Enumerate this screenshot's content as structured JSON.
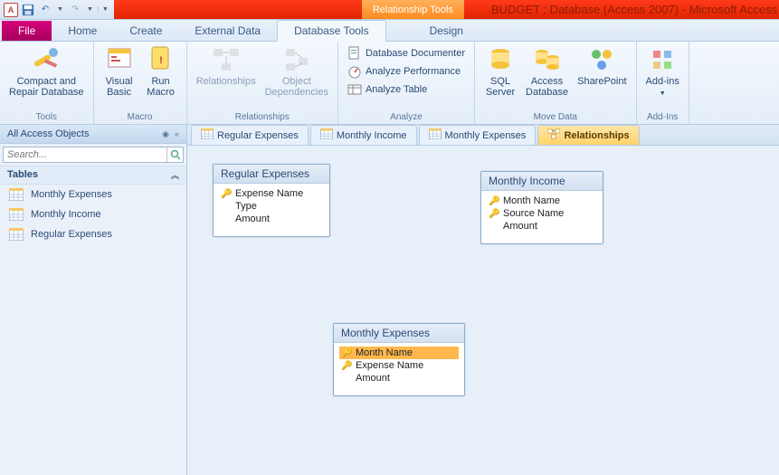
{
  "titlebar": {
    "app_letter": "A",
    "context_tools": "Relationship Tools",
    "window_title": "BUDGET : Database (Access 2007) - Microsoft Access"
  },
  "tabs": {
    "file": "File",
    "home": "Home",
    "create": "Create",
    "external": "External Data",
    "dbtools": "Database Tools",
    "design": "Design"
  },
  "ribbon": {
    "groups": {
      "tools": {
        "label": "Tools",
        "compact": "Compact and\nRepair Database"
      },
      "macro": {
        "label": "Macro",
        "vb": "Visual\nBasic",
        "run": "Run\nMacro"
      },
      "relationships": {
        "label": "Relationships",
        "rel": "Relationships",
        "dep": "Object\nDependencies"
      },
      "analyze": {
        "label": "Analyze",
        "doc": "Database Documenter",
        "perf": "Analyze Performance",
        "table": "Analyze Table"
      },
      "movedata": {
        "label": "Move Data",
        "sql": "SQL\nServer",
        "adb": "Access\nDatabase",
        "sp": "SharePoint"
      },
      "addins": {
        "label": "Add-Ins",
        "addins": "Add-ins"
      }
    }
  },
  "nav": {
    "header": "All Access Objects",
    "search_placeholder": "Search...",
    "group": "Tables",
    "items": [
      "Monthly Expenses",
      "Monthly Income",
      "Regular Expenses"
    ]
  },
  "doc_tabs": [
    "Regular Expenses",
    "Monthly Income",
    "Monthly Expenses",
    "Relationships"
  ],
  "tables": {
    "regular": {
      "title": "Regular Expenses",
      "fields": [
        {
          "name": "Expense Name",
          "key": true
        },
        {
          "name": "Type",
          "key": false
        },
        {
          "name": "Amount",
          "key": false
        }
      ]
    },
    "income": {
      "title": "Monthly Income",
      "fields": [
        {
          "name": "Month Name",
          "key": true
        },
        {
          "name": "Source Name",
          "key": true
        },
        {
          "name": "Amount",
          "key": false
        }
      ]
    },
    "expenses": {
      "title": "Monthly Expenses",
      "fields": [
        {
          "name": "Month Name",
          "key": true,
          "selected": true
        },
        {
          "name": "Expense Name",
          "key": true
        },
        {
          "name": "Amount",
          "key": false
        }
      ]
    }
  }
}
